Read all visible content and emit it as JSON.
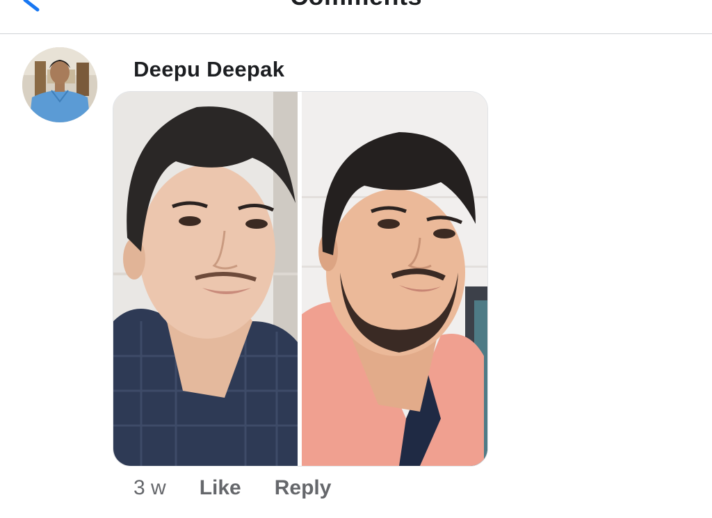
{
  "header": {
    "title": "Comments",
    "back_icon": "chevron-left-icon",
    "accent_color": "#1877f2"
  },
  "comment": {
    "author": "Deepu Deepak",
    "avatar": "profile-photo",
    "attachment": {
      "type": "photo-collage",
      "images": [
        "selfie-left",
        "selfie-right"
      ]
    },
    "timestamp": "3 w",
    "like_label": "Like",
    "reply_label": "Reply"
  },
  "colors": {
    "meta_text": "#65676b",
    "name_text": "#1c1e21",
    "divider": "#cfd2d6"
  }
}
